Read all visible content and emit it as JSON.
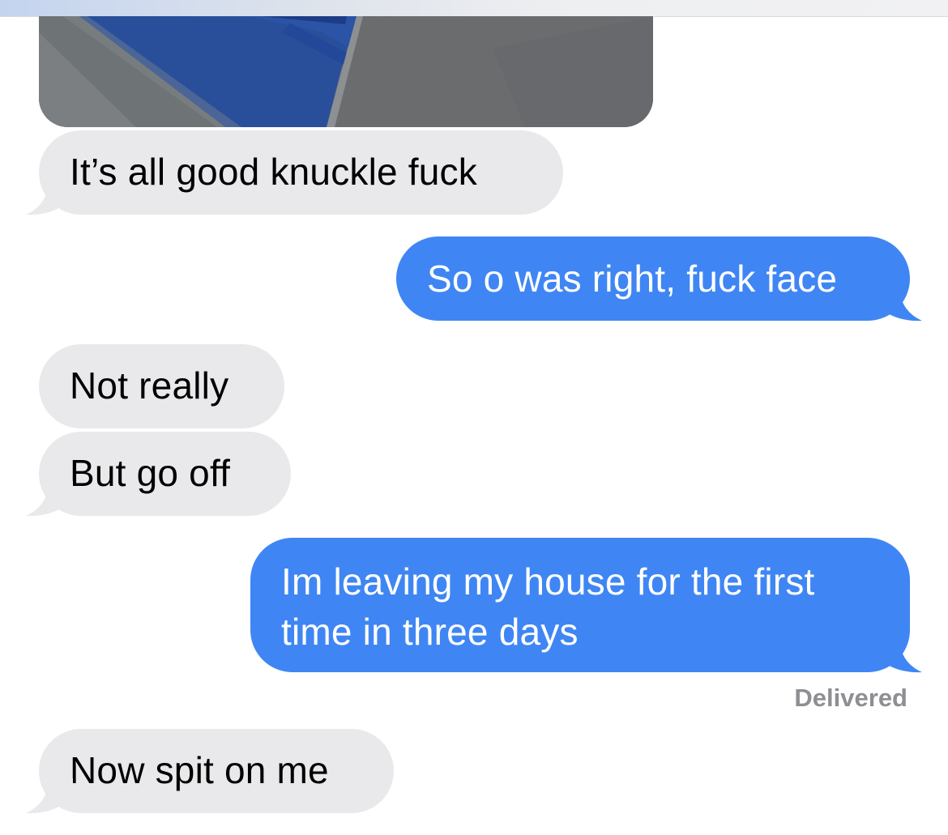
{
  "conversation": {
    "messages": [
      {
        "side": "received",
        "text": "It’s all good knuckle fuck"
      },
      {
        "side": "sent",
        "text": "So o was right, fuck face"
      },
      {
        "side": "received",
        "text": "Not really"
      },
      {
        "side": "received",
        "text": "But go off"
      },
      {
        "side": "sent",
        "text": "Im leaving my house for the first time in three days"
      },
      {
        "side": "received",
        "text": "Now spit on me"
      }
    ],
    "delivered_status": "Delivered"
  },
  "colors": {
    "sent_bubble": "#3f86f4",
    "received_bubble": "#e9e9eb",
    "status_text": "#8e8e93"
  }
}
